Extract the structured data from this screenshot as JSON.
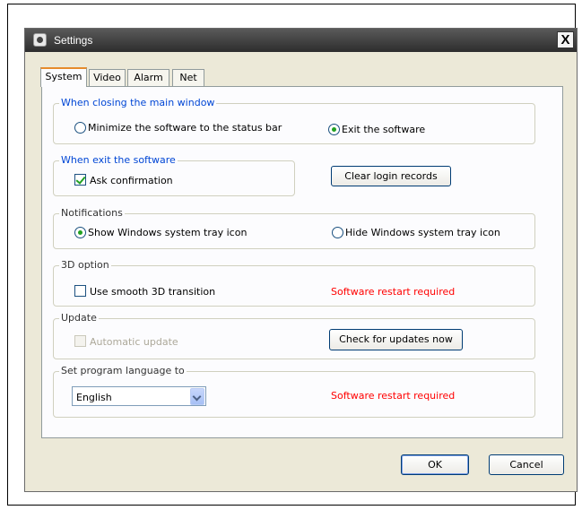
{
  "window": {
    "title": "Settings",
    "close_label": "✕"
  },
  "tabs": [
    {
      "label": "System",
      "active": true
    },
    {
      "label": "Video",
      "active": false
    },
    {
      "label": "Alarm",
      "active": false
    },
    {
      "label": "Net",
      "active": false
    }
  ],
  "groups": {
    "closing": {
      "legend": "When closing the main window",
      "option_minimize": "Minimize the software to the status bar",
      "option_exit": "Exit the software",
      "selected": "option_exit"
    },
    "exit": {
      "legend": "When exit the software",
      "ask_confirmation": "Ask confirmation",
      "ask_confirmation_checked": true,
      "clear_button": "Clear login records"
    },
    "notifications": {
      "legend": "Notifications",
      "option_show": "Show Windows system tray icon",
      "option_hide": "Hide Windows system tray icon",
      "selected": "option_show"
    },
    "option3d": {
      "legend": "3D option",
      "smooth": "Use smooth 3D transition",
      "smooth_checked": false,
      "restart_note": "Software restart required"
    },
    "update": {
      "legend": "Update",
      "auto": "Automatic update",
      "auto_checked": false,
      "check_button": "Check for updates now"
    },
    "language": {
      "legend": "Set program language to",
      "selected_language": "English",
      "restart_note": "Software restart required"
    }
  },
  "footer": {
    "ok_label": "OK",
    "cancel_label": "Cancel"
  },
  "colors": {
    "legend": "#0046d5",
    "warning": "#ff0000",
    "titlebar": "#3c3c3c",
    "tab_accent": "#e68b2c"
  }
}
